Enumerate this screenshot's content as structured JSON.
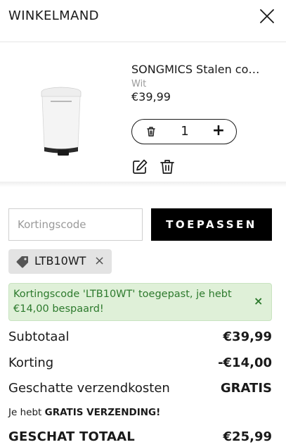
{
  "header": {
    "title": "WINKELMAND",
    "close_icon": "close-icon"
  },
  "cart_item": {
    "name": "SONGMICS Stalen co…",
    "variant": "Wit",
    "price": "€39,99",
    "quantity": "1",
    "quantity_remove_icon": "trash-icon",
    "quantity_add_icon": "plus-icon",
    "quantity_add_glyph": "+",
    "edit_icon": "edit-icon",
    "delete_icon": "trash-icon"
  },
  "coupon": {
    "placeholder": "Kortingscode",
    "apply_label": "TOEPASSEN",
    "applied_code": "LTB10WT",
    "tag_icon": "tag-icon",
    "remove_glyph": "×"
  },
  "notice": {
    "text": "Kortingscode 'LTB10WT' toegepast, je hebt €14,00 bespaard!",
    "close_glyph": "×"
  },
  "summary": {
    "subtotal_label": "Subtotaal",
    "subtotal_value": "€39,99",
    "discount_label": "Korting",
    "discount_value": "-€14,00",
    "shipping_label": "Geschatte verzendkosten",
    "shipping_value": "GRATIS",
    "free_shipping_prefix": "Je hebt ",
    "free_shipping_bold": "GRATIS VERZENDING!",
    "total_label": "GESCHAT TOTAAL",
    "total_value": "€25,99"
  },
  "colors": {
    "accent": "#000000",
    "notice_bg": "#dff0d8",
    "notice_text": "#2d7a2d",
    "tag_bg": "#e3e3e3"
  }
}
